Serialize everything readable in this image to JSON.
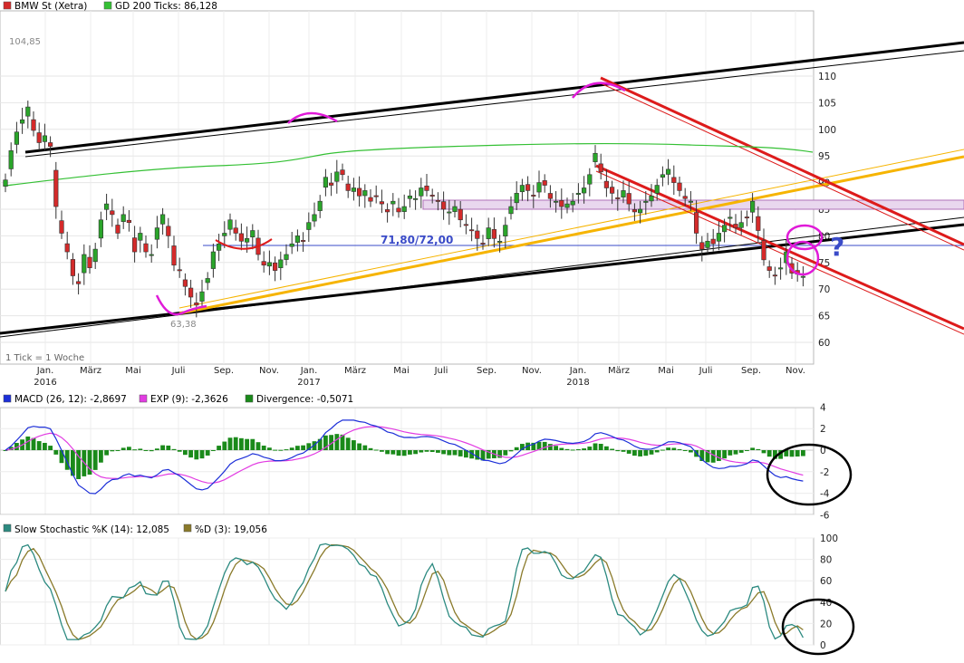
{
  "colors": {
    "up": "#2aa52a",
    "down": "#d42a2a",
    "gd200": "#34c034",
    "macd": "#1c2fd8",
    "exp": "#e23ce2",
    "divergence": "#1a8a1a",
    "stoch_k": "#2c8a80",
    "stoch_d": "#8a7a2a",
    "trend_black": "#000000",
    "trend_red": "#dd1b1b",
    "trend_yellow": "#f6b400",
    "zone_fill": "#e9d7ee",
    "annot_magenta": "#e01ad8",
    "annot_blue": "#3a4bc8"
  },
  "price_panel": {
    "legend": [
      {
        "label": "BMW St (Xetra)",
        "swatch": "#d42a2a"
      },
      {
        "label": "GD 200 Ticks: 86,128",
        "swatch": "#34c034"
      }
    ],
    "tick_note": "1 Tick = 1 Woche",
    "y_ticks": [
      "110",
      "105",
      "100",
      "95",
      "90",
      "85",
      "80",
      "75",
      "70",
      "65",
      "60"
    ],
    "x_ticks": [
      "Jan.",
      "März",
      "Mai",
      "Juli",
      "Sep.",
      "Nov.",
      "Jan.",
      "März",
      "Mai",
      "Juli",
      "Sep.",
      "Nov.",
      "Jan.",
      "März",
      "Mai",
      "Juli",
      "Sep.",
      "Nov."
    ],
    "years": [
      "2016",
      "2017",
      "2018"
    ],
    "high_label": "104,85",
    "low_label": "63,38",
    "level_label": "71,80/72,00",
    "question_mark": "?"
  },
  "macd_panel": {
    "legend": [
      {
        "label": "MACD (26, 12): -2,8697",
        "swatch": "#1c2fd8"
      },
      {
        "label": "EXP (9): -2,3626",
        "swatch": "#e23ce2"
      },
      {
        "label": "Divergence: -0,5071",
        "swatch": "#1a8a1a"
      }
    ],
    "y_ticks": [
      "4",
      "2",
      "0",
      "-2",
      "-4",
      "-6"
    ]
  },
  "stoch_panel": {
    "legend": [
      {
        "label": "Slow Stochastic %K (14): 12,085",
        "swatch": "#2c8a80"
      },
      {
        "label": "%D (3): 19,056",
        "swatch": "#8a7a2a"
      }
    ],
    "y_ticks": [
      "100",
      "80",
      "60",
      "40",
      "20",
      "0"
    ]
  },
  "chart_data": {
    "type": "candlestick",
    "instrument": "BMW St (Xetra)",
    "interval": "1 Tick = 1 Woche",
    "ylim": [
      58,
      112
    ],
    "close": [
      90.5,
      96,
      99.5,
      101.8,
      104.2,
      99.8,
      97.5,
      98.8,
      96.8,
      85.5,
      80.5,
      77,
      72.5,
      71,
      76.5,
      74,
      77.5,
      83,
      86,
      84,
      80.5,
      84,
      82.5,
      77,
      80.5,
      77,
      76.5,
      81.5,
      84,
      80,
      74.5,
      73.5,
      70.5,
      68.5,
      67,
      69.5,
      72,
      77,
      78.5,
      80.5,
      83,
      80.5,
      79,
      79.5,
      81,
      76.5,
      74.5,
      75,
      73.5,
      75.5,
      76.5,
      78.5,
      80,
      79,
      82.5,
      84,
      86.5,
      91,
      89.5,
      92,
      91.5,
      88.5,
      89,
      87.5,
      88.5,
      86.5,
      87.5,
      86,
      84.5,
      86.5,
      84.5,
      85.5,
      87.5,
      87,
      89,
      88.5,
      87.5,
      86.5,
      85,
      84.5,
      85.5,
      83,
      82,
      81,
      79.5,
      78.5,
      81.5,
      79.5,
      79,
      82,
      85.5,
      88,
      89.5,
      88.5,
      87.5,
      90,
      89.5,
      87,
      86.5,
      85.5,
      86,
      86.5,
      88,
      89,
      91.5,
      95.5,
      92,
      89,
      88,
      87,
      88.5,
      86,
      84.5,
      85,
      86.5,
      87.5,
      89.5,
      91.5,
      92.5,
      90,
      88.5,
      87,
      86.5,
      80.5,
      77.5,
      79,
      78.5,
      80.5,
      82,
      83.5,
      81.5,
      82.5,
      83.5,
      86.5,
      81,
      75.5,
      73.5,
      72.5,
      74,
      77,
      73,
      72.8,
      72.4
    ],
    "gd200": {
      "label": "GD 200 Ticks",
      "last": 86.128
    },
    "annotations": {
      "high": 104.85,
      "low": 63.38,
      "support_zone": [
        71.8,
        72.0
      ]
    }
  }
}
